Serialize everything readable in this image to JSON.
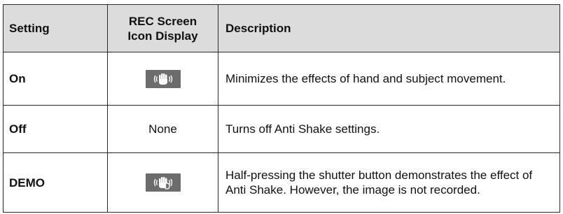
{
  "table": {
    "headers": {
      "setting": "Setting",
      "icon_line1": "REC Screen",
      "icon_line2": "Icon Display",
      "description": "Description"
    },
    "rows": [
      {
        "setting": "On",
        "icon": "anti-shake-hand-icon",
        "icon_text": "",
        "description": "Minimizes the effects of hand and subject movement."
      },
      {
        "setting": "Off",
        "icon": "",
        "icon_text": "None",
        "description": "Turns off Anti Shake settings."
      },
      {
        "setting": "DEMO",
        "icon": "anti-shake-demo-icon",
        "icon_text": "",
        "description": "Half-pressing the shutter button demonstrates the effect of Anti Shake. However, the image is not recorded."
      }
    ]
  },
  "colors": {
    "header_bg": "#dcdcdc",
    "border": "#2a2a2a",
    "icon_bg": "#6c6c6c",
    "icon_fg": "#ffffff"
  }
}
